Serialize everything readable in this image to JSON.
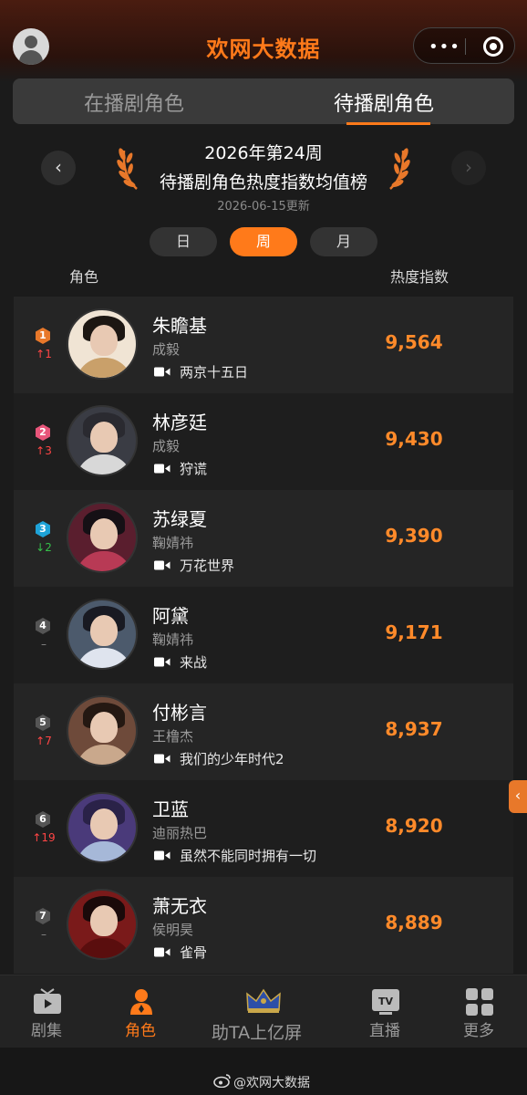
{
  "header": {
    "title": "欢网大数据"
  },
  "tabs": [
    {
      "label": "在播剧角色",
      "active": false
    },
    {
      "label": "待播剧角色",
      "active": true
    }
  ],
  "ranking": {
    "week_title": "2026年第24周",
    "title": "待播剧角色热度指数均值榜",
    "updated": "2026-06-15更新",
    "periods": [
      "日",
      "周",
      "月"
    ],
    "active_period": "周",
    "col_role": "角色",
    "col_heat": "热度指数"
  },
  "rows": [
    {
      "rank": "1",
      "trend": "1",
      "trend_dir": "up",
      "trend_symbol": "↑1",
      "name": "朱瞻基",
      "actor": "成毅",
      "drama": "两京十五日",
      "score": "9,564",
      "badge_color": "#e8782a"
    },
    {
      "rank": "2",
      "trend": "3",
      "trend_dir": "up",
      "trend_symbol": "↑3",
      "name": "林彦廷",
      "actor": "成毅",
      "drama": "狩谎",
      "score": "9,430",
      "badge_color": "#e8557a"
    },
    {
      "rank": "3",
      "trend": "2",
      "trend_dir": "down",
      "trend_symbol": "↓2",
      "name": "苏绿夏",
      "actor": "鞠婧祎",
      "drama": "万花世界",
      "score": "9,390",
      "badge_color": "#1ea3d8"
    },
    {
      "rank": "4",
      "trend": "",
      "trend_dir": "flat",
      "trend_symbol": "–",
      "name": "阿黛",
      "actor": "鞠婧祎",
      "drama": "来战",
      "score": "9,171",
      "badge_color": "#555555"
    },
    {
      "rank": "5",
      "trend": "7",
      "trend_dir": "up",
      "trend_symbol": "↑7",
      "name": "付彬言",
      "actor": "王橹杰",
      "drama": "我们的少年时代2",
      "score": "8,937",
      "badge_color": "#555555"
    },
    {
      "rank": "6",
      "trend": "19",
      "trend_dir": "up",
      "trend_symbol": "↑19",
      "name": "卫蓝",
      "actor": "迪丽热巴",
      "drama": "虽然不能同时拥有一切",
      "score": "8,920",
      "badge_color": "#555555"
    },
    {
      "rank": "7",
      "trend": "",
      "trend_dir": "flat",
      "trend_symbol": "–",
      "name": "萧无衣",
      "actor": "侯明昊",
      "drama": "雀骨",
      "score": "8,889",
      "badge_color": "#555555"
    }
  ],
  "bottom_nav": [
    {
      "label": "剧集",
      "icon": "tv-icon"
    },
    {
      "label": "角色",
      "icon": "role-icon",
      "active": true
    },
    {
      "label": "助TA上亿屏",
      "icon": "crown-icon"
    },
    {
      "label": "直播",
      "icon": "live-tv-icon"
    },
    {
      "label": "更多",
      "icon": "grid-icon"
    }
  ],
  "footer": {
    "text": "@欢网大数据"
  }
}
